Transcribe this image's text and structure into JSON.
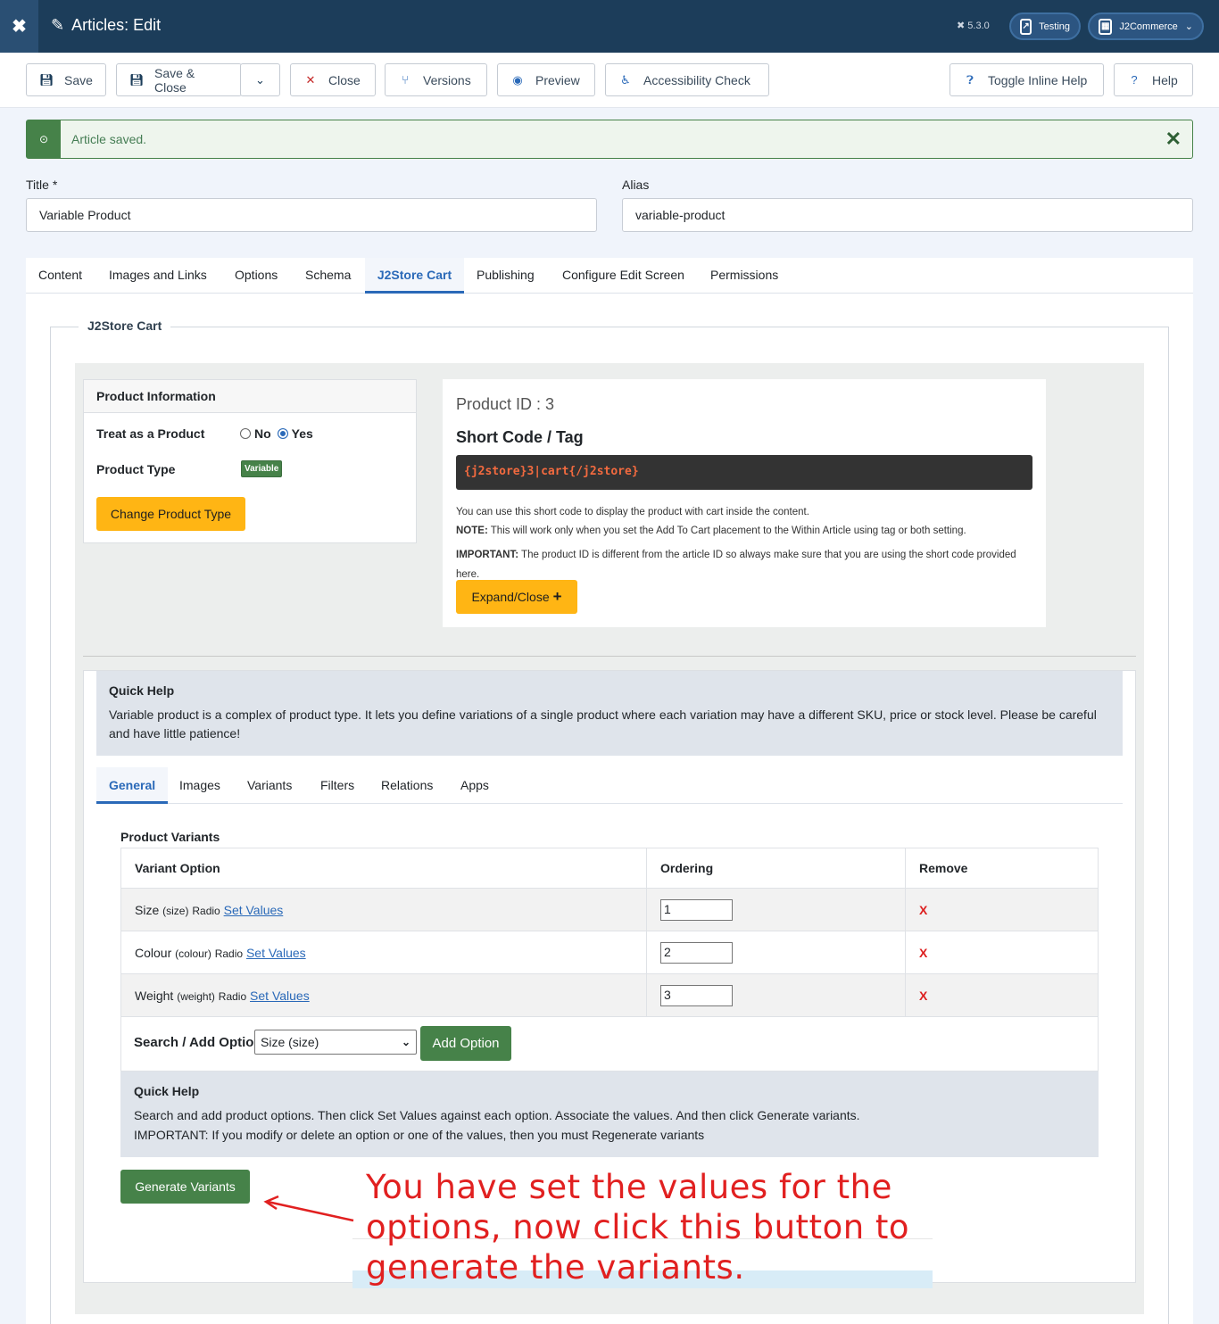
{
  "header": {
    "logo": "✖",
    "title": "Articles: Edit",
    "version": "5.3.0",
    "testing": "Testing",
    "user": "J2Commerce"
  },
  "toolbar": {
    "save": "Save",
    "save_close": "Save & Close",
    "close": "Close",
    "versions": "Versions",
    "preview": "Preview",
    "accessibility": "Accessibility Check",
    "toggle_help": "Toggle Inline Help",
    "help": "Help"
  },
  "alert": {
    "message": "Article saved."
  },
  "form": {
    "title_label": "Title *",
    "title_value": "Variable Product",
    "alias_label": "Alias",
    "alias_value": "variable-product"
  },
  "tabs": [
    "Content",
    "Images and Links",
    "Options",
    "Schema",
    "J2Store Cart",
    "Publishing",
    "Configure Edit Screen",
    "Permissions"
  ],
  "j2store": {
    "legend": "J2Store Cart",
    "product_info": {
      "heading": "Product Information",
      "treat_label": "Treat as a Product",
      "no": "No",
      "yes": "Yes",
      "selected": "Yes",
      "type_label": "Product Type",
      "type_badge": "Variable",
      "change_button": "Change Product Type"
    },
    "shortcode": {
      "product_id": "Product ID : 3",
      "heading": "Short Code / Tag",
      "code": "{j2store}3|cart{/j2store}",
      "line1": "You can use this short code to display the product with cart inside the content.",
      "note_label": "NOTE:",
      "note": " This will work only when you set the Add To Cart placement to the Within Article using tag or both setting.",
      "important_label": "IMPORTANT:",
      "important": " The product ID is different from the article ID so always make sure that you are using the short code provided here.",
      "expand_button": "Expand/Close"
    },
    "quick_help": {
      "title": "Quick Help",
      "text": "Variable product is a complex of product type. It lets you define variations of a single product where each variation may have a different SKU, price or stock level. Please be careful and have little patience!"
    },
    "subtabs": [
      "General",
      "Images",
      "Variants",
      "Filters",
      "Relations",
      "Apps"
    ],
    "variants": {
      "title": "Product Variants",
      "headers": [
        "Variant Option",
        "Ordering",
        "Remove"
      ],
      "rows": [
        {
          "name": "Size",
          "code": "(size)",
          "type": "Radio",
          "link": "Set Values",
          "order": "1",
          "remove": "X"
        },
        {
          "name": "Colour",
          "code": "(colour)",
          "type": "Radio",
          "link": "Set Values",
          "order": "2",
          "remove": "X"
        },
        {
          "name": "Weight",
          "code": "(weight)",
          "type": "Radio",
          "link": "Set Values",
          "order": "3",
          "remove": "X"
        }
      ],
      "search_label": "Search / Add Option",
      "select_value": "Size (size)",
      "add_button": "Add Option"
    },
    "quick_help2": {
      "title": "Quick Help",
      "line1": "Search and add product options. Then click Set Values against each option. Associate the values. And then click Generate variants.",
      "line2": "IMPORTANT: If you modify or delete an option or one of the values, then you must Regenerate variants"
    },
    "generate_button": "Generate Variants"
  },
  "annotation": "You have set the values for the options, now click this button to generate the variants.",
  "colors": {
    "header": "#1c3d5a",
    "accent": "#2a69b8",
    "success": "#468249",
    "warning": "#ffb514",
    "danger": "#dd2020",
    "annotation": "#e12020"
  }
}
